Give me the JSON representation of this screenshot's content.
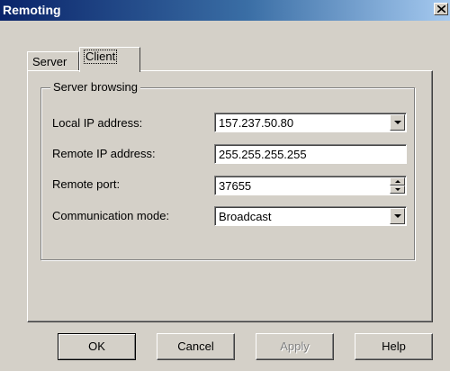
{
  "window": {
    "title": "Remoting"
  },
  "tabs": [
    {
      "label": "Server",
      "selected": false
    },
    {
      "label": "Client",
      "selected": true
    }
  ],
  "group": {
    "title": "Server browsing",
    "fields": {
      "local_ip": {
        "label": "Local IP address:",
        "value": "157.237.50.80"
      },
      "remote_ip": {
        "label": "Remote IP address:",
        "value": "255.255.255.255"
      },
      "remote_port": {
        "label": "Remote port:",
        "value": "37655"
      },
      "comm_mode": {
        "label": "Communication mode:",
        "value": "Broadcast"
      }
    }
  },
  "buttons": {
    "ok": "OK",
    "cancel": "Cancel",
    "apply": "Apply",
    "help": "Help"
  },
  "icons": {
    "close": "close-icon",
    "dropdown": "chevron-down-icon",
    "spin_up": "spin-up-icon",
    "spin_down": "spin-down-icon"
  },
  "colors": {
    "titlebar_start": "#0a246a",
    "titlebar_end": "#a6caf0",
    "face": "#d4d0c8"
  }
}
